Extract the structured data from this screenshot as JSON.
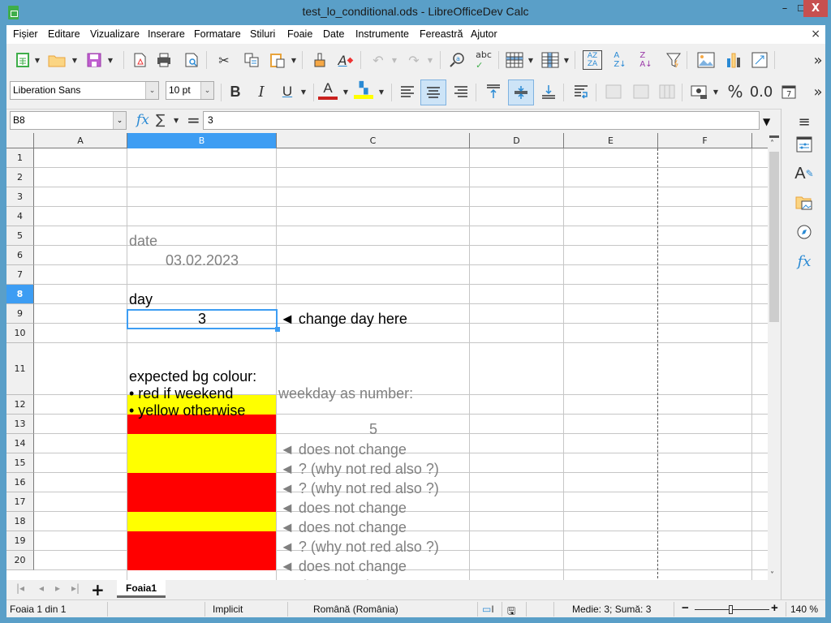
{
  "window": {
    "title": "test_lo_conditional.ods - LibreOfficeDev Calc",
    "minimize": "–",
    "maximize": "☐",
    "close": "X"
  },
  "menu": {
    "items": [
      "Fișier",
      "Editare",
      "Vizualizare",
      "Inserare",
      "Formatare",
      "Stiluri",
      "Foaie",
      "Date",
      "Instrumente",
      "Fereastră",
      "Ajutor"
    ],
    "close_doc": "×"
  },
  "toolbar": {
    "font_name": "Liberation Sans",
    "font_size": "10 pt",
    "bold": "B",
    "italic": "I",
    "underline": "U",
    "percent": "%",
    "decimal": "0.0",
    "more": "»",
    "font_color": "#c9211e",
    "highlight_color": "#ffff00"
  },
  "formula": {
    "cell_ref": "B8",
    "fx": "fx",
    "sigma": "∑",
    "equals": "=",
    "content": "3"
  },
  "columns": [
    {
      "label": "A",
      "selected": false
    },
    {
      "label": "B",
      "selected": true
    },
    {
      "label": "C",
      "selected": false
    },
    {
      "label": "D",
      "selected": false
    },
    {
      "label": "E",
      "selected": false
    },
    {
      "label": "F",
      "selected": false
    }
  ],
  "rows": [
    {
      "label": "1"
    },
    {
      "label": "2"
    },
    {
      "label": "3"
    },
    {
      "label": "4"
    },
    {
      "label": "5"
    },
    {
      "label": "6"
    },
    {
      "label": "7"
    },
    {
      "label": "8",
      "selected": true
    },
    {
      "label": "9"
    },
    {
      "label": "10"
    },
    {
      "label": "11"
    },
    {
      "label": "12"
    },
    {
      "label": "13"
    },
    {
      "label": "14"
    },
    {
      "label": "15"
    },
    {
      "label": "16"
    },
    {
      "label": "17"
    },
    {
      "label": "18"
    },
    {
      "label": "19"
    },
    {
      "label": "20"
    }
  ],
  "cells": {
    "B4": "date",
    "B5": "03.02.2023",
    "B7": "day",
    "B8": "3",
    "C8": "◄ change day here",
    "B11_line1": "expected bg colour:",
    "B11_line2": "• red if weekend",
    "B11_line3": "• yellow otherwise",
    "C11": "weekday as number:",
    "C12": "5",
    "C13": "◄ does not change",
    "C14": "◄ ? (why not red also ?)",
    "C15": "◄ ? (why not red also ?)",
    "C16": "◄ does not change",
    "C17": "◄ does not change",
    "C18": "◄ ? (why not red also ?)",
    "C19": "◄ does not change",
    "C20": "◄ does not change"
  },
  "fills": {
    "B12": "yellow",
    "B13": "red",
    "B14": "yellow",
    "B15": "yellow",
    "B16": "red",
    "B17": "red",
    "B18": "yellow",
    "B19": "red",
    "B20": "red"
  },
  "colors": {
    "yellow": "#ffff00",
    "red": "#ff0000",
    "gray_text": "#808080",
    "selection": "#3d9df3"
  },
  "sheets": {
    "add": "+",
    "tabs": [
      "Foaia1"
    ]
  },
  "status": {
    "sheet": "Foaia 1 din 1",
    "page_style": "Implicit",
    "language": "Română (România)",
    "summary": "Medie: 3; Sumă: 3",
    "zoom_minus": "−",
    "zoom_plus": "+",
    "zoom": "140 %"
  }
}
